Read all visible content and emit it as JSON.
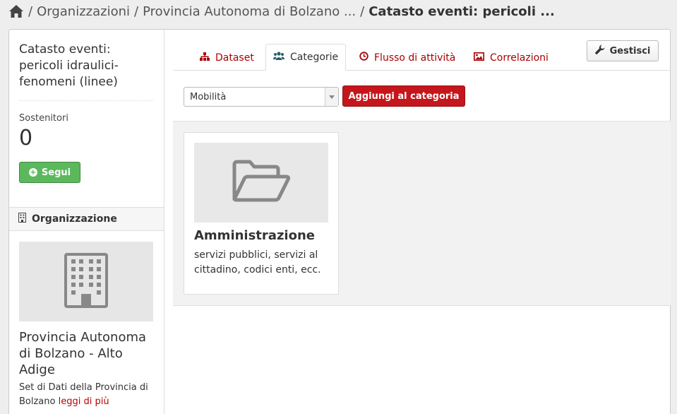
{
  "breadcrumb": {
    "home_icon": "home-icon",
    "items": [
      "Organizzazioni",
      "Provincia Autonoma di Bolzano ...",
      "Catasto eventi: pericoli ..."
    ]
  },
  "sidebar": {
    "dataset_title": "Catasto eventi: pericoli idraulici-fenomeni (linee)",
    "followers_label": "Sostenitori",
    "followers_count": "0",
    "follow_button": "Segui",
    "org_section_label": "Organizzazione",
    "org_name": "Provincia Autonoma di Bolzano - Alto Adige",
    "org_description": "Set di Dati della Provincia di Bolzano",
    "read_more": "leggi di più"
  },
  "tabs": [
    {
      "label": "Dataset",
      "icon": "sitemap-icon"
    },
    {
      "label": "Categorie",
      "icon": "users-icon",
      "active": true
    },
    {
      "label": "Flusso di attività",
      "icon": "clock-icon"
    },
    {
      "label": "Correlazioni",
      "icon": "picture-icon"
    }
  ],
  "manage_button": "Gestisci",
  "category_select": {
    "selected": "Mobilità"
  },
  "add_button": "Aggiungi al categoria",
  "category_cards": [
    {
      "title": "Amministrazione",
      "description": "servizi pubblici, servizi al cittadino, codici enti, ecc.",
      "icon": "folder-open-icon"
    }
  ],
  "colors": {
    "accent": "#c4161c",
    "link": "#aa0000",
    "follow": "#5cb85c"
  }
}
